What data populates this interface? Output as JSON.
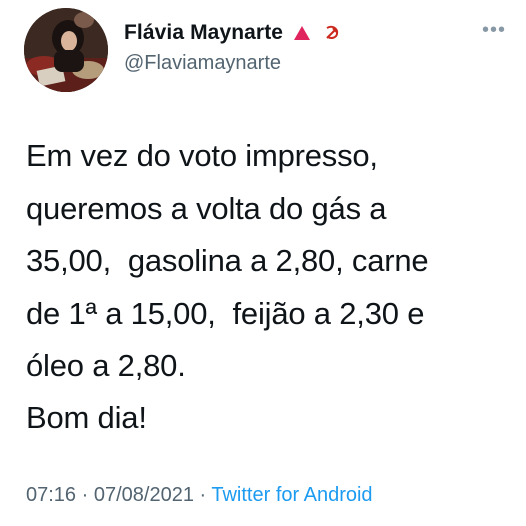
{
  "user": {
    "display_name": "Flávia Maynarte",
    "handle": "@Flaviamaynarte",
    "name_icons": [
      "red-triangle-icon",
      "hammer-sickle-icon"
    ]
  },
  "menu": {
    "more_icon": "more-horizontal-icon"
  },
  "tweet": {
    "lines": [
      "Em vez do voto impresso,",
      "queremos a volta do gás a",
      "35,00,  gasolina a 2,80, carne",
      "de 1ª a 15,00,  feijão a 2,30 e",
      "óleo a 2,80."
    ],
    "greeting": "Bom dia!"
  },
  "meta": {
    "time": "07:16",
    "separator1": " · ",
    "date": "07/08/2021",
    "separator2": " · ",
    "source": "Twitter for Android"
  },
  "colors": {
    "text": "#0f1419",
    "secondary": "#536471",
    "link": "#1d9bf0",
    "triangle": "#e0245e",
    "hammer": "#cc2a1e"
  }
}
